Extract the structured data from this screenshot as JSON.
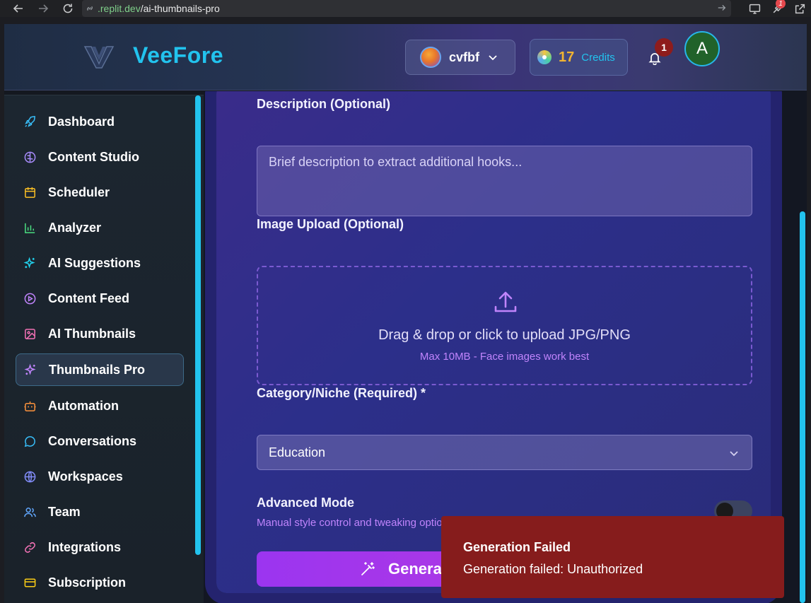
{
  "browser": {
    "url_host": ".replit.dev",
    "url_path": "/ai-thumbnails-pro",
    "extension_badge": "1"
  },
  "header": {
    "brand": "VeeFore",
    "workspace_name": "cvfbf",
    "credits_value": "17",
    "credits_label": "Credits",
    "notification_count": "1",
    "user_initial": "A"
  },
  "sidebar": {
    "items": [
      {
        "label": "Dashboard",
        "icon": "rocket-icon",
        "color": "#38bdf8"
      },
      {
        "label": "Content Studio",
        "icon": "brain-icon",
        "color": "#a78bfa"
      },
      {
        "label": "Scheduler",
        "icon": "calendar-icon",
        "color": "#fbbf24"
      },
      {
        "label": "Analyzer",
        "icon": "bar-chart-icon",
        "color": "#4ade80"
      },
      {
        "label": "AI Suggestions",
        "icon": "sparkles-icon",
        "color": "#22d3ee"
      },
      {
        "label": "Content Feed",
        "icon": "play-circle-icon",
        "color": "#c084fc"
      },
      {
        "label": "AI Thumbnails",
        "icon": "image-icon",
        "color": "#f472b6"
      },
      {
        "label": "Thumbnails Pro",
        "icon": "sparkles-icon",
        "color": "#c084fc",
        "active": true
      },
      {
        "label": "Automation",
        "icon": "bot-icon",
        "color": "#fb923c"
      },
      {
        "label": "Conversations",
        "icon": "chat-icon",
        "color": "#38bdf8"
      },
      {
        "label": "Workspaces",
        "icon": "globe-icon",
        "color": "#818cf8"
      },
      {
        "label": "Team",
        "icon": "users-icon",
        "color": "#60a5fa"
      },
      {
        "label": "Integrations",
        "icon": "link-icon",
        "color": "#f472b6"
      },
      {
        "label": "Subscription",
        "icon": "credit-card-icon",
        "color": "#facc15"
      }
    ]
  },
  "form": {
    "description_label": "Description (Optional)",
    "description_placeholder": "Brief description to extract additional hooks...",
    "upload_label": "Image Upload (Optional)",
    "upload_main": "Drag & drop or click to upload JPG/PNG",
    "upload_sub": "Max 10MB - Face images work best",
    "category_label": "Category/Niche (Required) *",
    "category_value": "Education",
    "advanced_label": "Advanced Mode",
    "advanced_sub": "Manual style control and tweaking options",
    "advanced_enabled": false,
    "generate_label": "Generate"
  },
  "toast": {
    "title": "Generation Failed",
    "message": "Generation failed: Unauthorized",
    "color": "#861c1c"
  }
}
